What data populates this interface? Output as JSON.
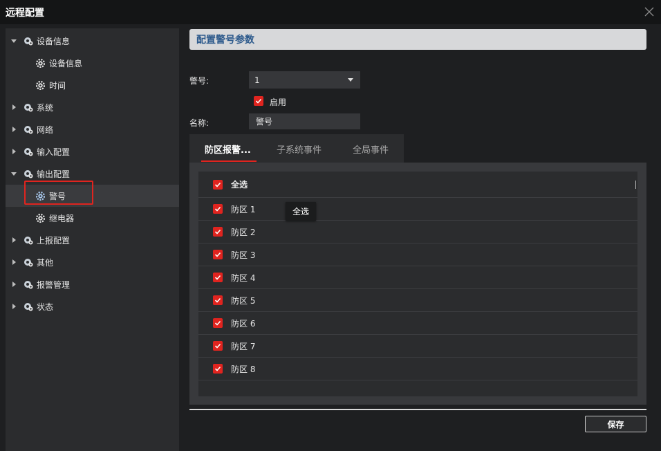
{
  "window": {
    "title": "远程配置"
  },
  "sidebar": {
    "items": [
      {
        "label": "设备信息",
        "level": 0,
        "expanded": true
      },
      {
        "label": "设备信息",
        "level": 1
      },
      {
        "label": "时间",
        "level": 1
      },
      {
        "label": "系统",
        "level": 0,
        "expanded": false
      },
      {
        "label": "网络",
        "level": 0,
        "expanded": false
      },
      {
        "label": "输入配置",
        "level": 0,
        "expanded": false
      },
      {
        "label": "输出配置",
        "level": 0,
        "expanded": true
      },
      {
        "label": "警号",
        "level": 1,
        "selected": true
      },
      {
        "label": "继电器",
        "level": 1
      },
      {
        "label": "上报配置",
        "level": 0,
        "expanded": false
      },
      {
        "label": "其他",
        "level": 0,
        "expanded": false
      },
      {
        "label": "报警管理",
        "level": 0,
        "expanded": false
      },
      {
        "label": "状态",
        "level": 0,
        "expanded": false
      }
    ]
  },
  "main": {
    "section_title": "配置警号参数",
    "siren_label": "警号:",
    "siren_value": "1",
    "enable_label": "启用",
    "enable_checked": true,
    "name_label": "名称:",
    "name_value": "警号",
    "tabs": [
      {
        "label": "防区报警...",
        "active": true
      },
      {
        "label": "子系统事件",
        "active": false
      },
      {
        "label": "全局事件",
        "active": false
      }
    ],
    "select_all_label": "全选",
    "zones": [
      "防区 1",
      "防区 2",
      "防区 3",
      "防区 4",
      "防区 5",
      "防区 6",
      "防区 7",
      "防区 8"
    ],
    "tooltip": "全选",
    "save_label": "保存"
  },
  "colors": {
    "accent": "#e0241f",
    "header_text": "#2d5a8c",
    "background": "#1e1f21",
    "panel": "#2b2c2e"
  }
}
